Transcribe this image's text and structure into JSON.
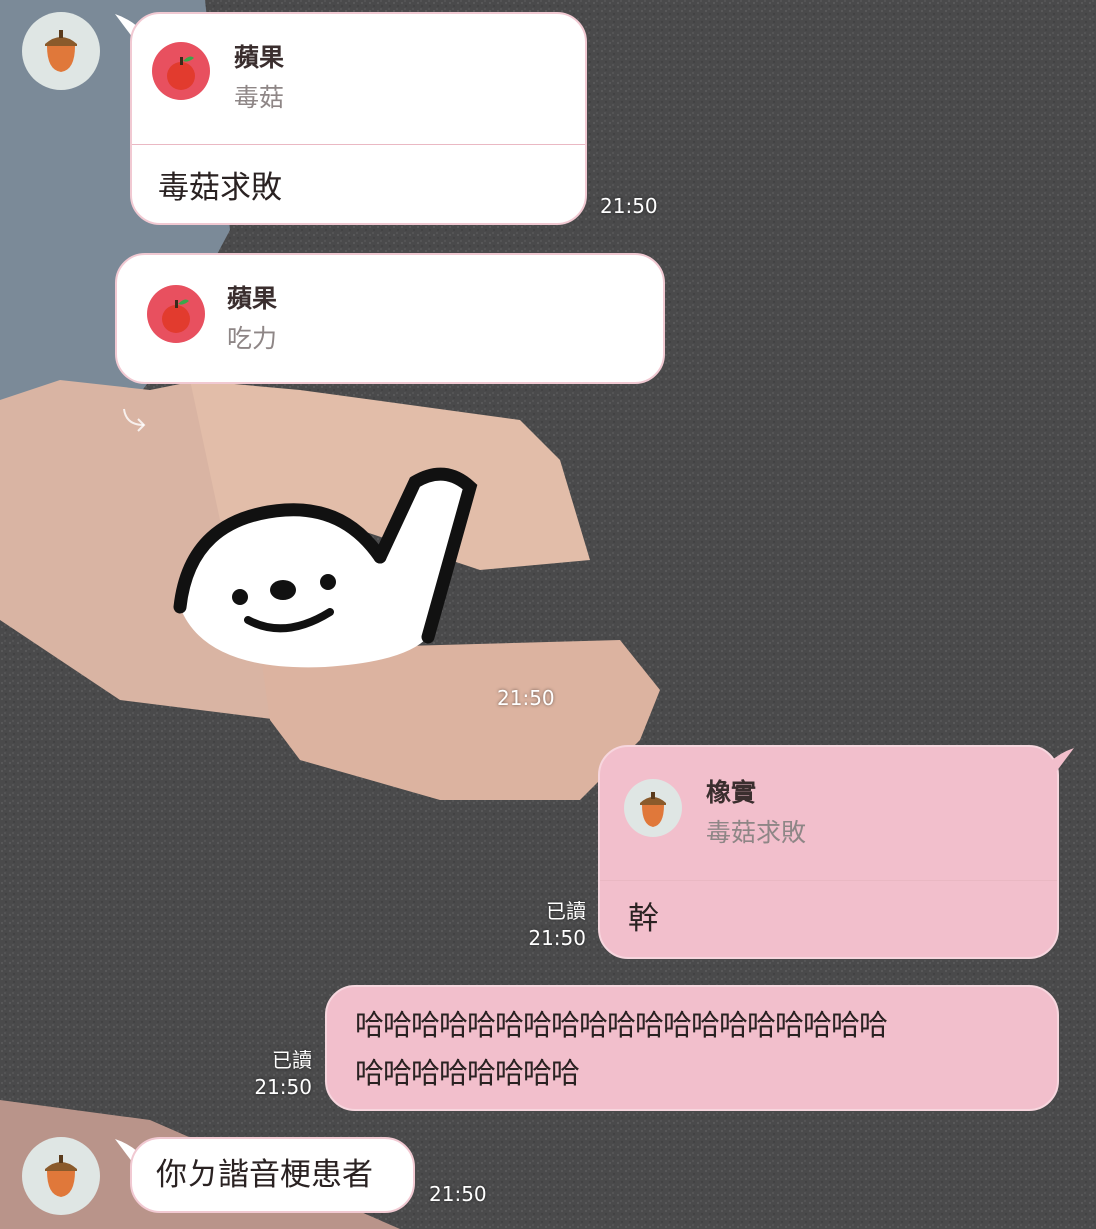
{
  "colors": {
    "sender_bubble": "#ffffff",
    "own_bubble": "#f2bfcc",
    "bubble_border": "#f1c9d2",
    "text": "#2a2222",
    "quote_name": "#3a2e2e",
    "quote_text": "#8e8686",
    "timestamp": "#ffffff"
  },
  "avatars": {
    "contact": "acorn-icon",
    "quote_apple": "apple-icon"
  },
  "messages": [
    {
      "id": "m1",
      "side": "left",
      "quote_name": "蘋果",
      "quote_text": "毒菇",
      "text": "毒菇求敗",
      "time": "21:50"
    },
    {
      "id": "m2",
      "side": "left",
      "quote_name": "蘋果",
      "quote_text": "吃力",
      "text": "",
      "time": ""
    },
    {
      "id": "m3",
      "side": "left",
      "sticker": "white-dog-waving-sticker",
      "time": "21:50"
    },
    {
      "id": "m4",
      "side": "right",
      "quote_name": "橡實",
      "quote_text": "毒菇求敗",
      "text": "幹",
      "read": "已讀",
      "time": "21:50"
    },
    {
      "id": "m5",
      "side": "right",
      "text_line1": "哈哈哈哈哈哈哈哈哈哈哈哈哈哈哈哈哈哈哈",
      "text_line2": "哈哈哈哈哈哈哈哈",
      "read": "已讀",
      "time": "21:50"
    },
    {
      "id": "m6",
      "side": "left",
      "text": "你ㄉ諧音梗患者",
      "time": "21:50"
    }
  ]
}
